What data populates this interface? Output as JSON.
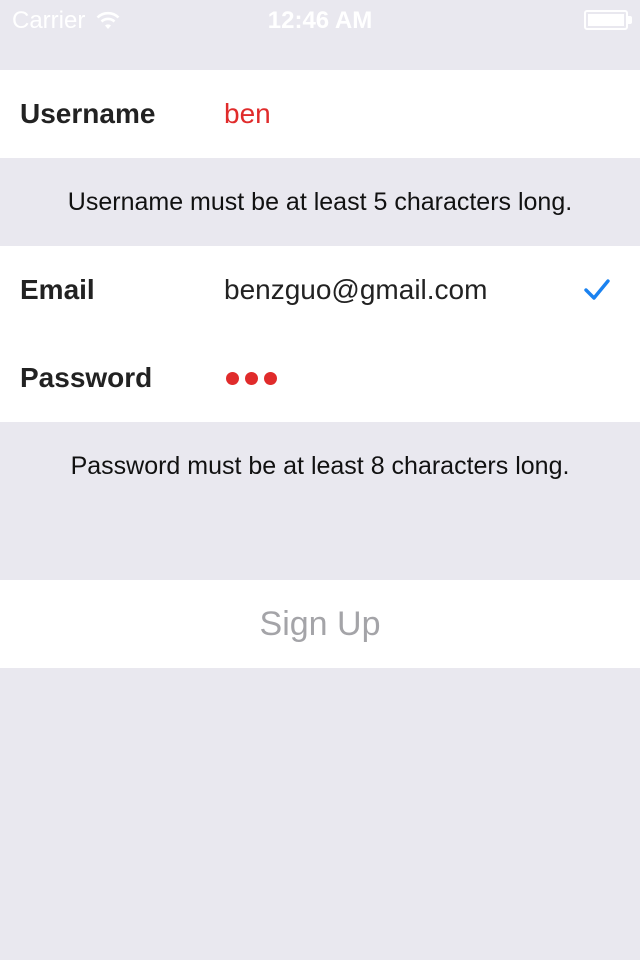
{
  "status_bar": {
    "carrier": "Carrier",
    "time": "12:46 AM"
  },
  "form": {
    "username": {
      "label": "Username",
      "value": "ben",
      "error": "Username must be at least 5 characters long."
    },
    "email": {
      "label": "Email",
      "value": "benzguo@gmail.com",
      "valid_icon": "checkmark-icon"
    },
    "password": {
      "label": "Password",
      "masked_length": 3,
      "error": "Password must be at least 8 characters long."
    },
    "submit": {
      "label": "Sign Up",
      "enabled": false
    }
  },
  "colors": {
    "background": "#e9e8ef",
    "invalid": "#e02b2b",
    "valid_check": "#1a82f0",
    "disabled_text": "#a4a4a8"
  }
}
